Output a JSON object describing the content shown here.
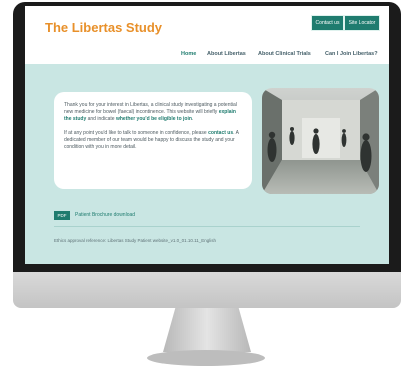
{
  "header": {
    "title": "The Libertas Study",
    "contact_button": "Contact us",
    "site_locator_button": "Site Locator"
  },
  "nav": {
    "items": [
      "Home",
      "About Libertas",
      "About Clinical Trials",
      "Can I Join Libertas?"
    ],
    "active": "Home"
  },
  "intro": {
    "p1_start": "Thank you for your interest in Libertas, a clinical study investigating a potential new medicine for bowel (faecal) incontinence. This website will briefly ",
    "p1_link1": "explain the study",
    "p1_middle": " and indicate ",
    "p1_link2": "whether you'd be eligible to join",
    "p1_end": ".",
    "p2_start": "If at any point you'd like to talk to someone in confidence, please ",
    "p2_link": "contact us",
    "p2_end": ". A dedicated member of our team would be happy to discuss the study and your condition with you in more detail."
  },
  "download": {
    "badge": "PDF",
    "label": "Patient Brochure download"
  },
  "footer": {
    "ethics": "Ethics approval reference: Libertas Study Patient website_v1.0_01.10.11_English"
  },
  "colors": {
    "accent": "#1f7c6f",
    "title": "#e8902a",
    "background": "#c9e6e3"
  }
}
